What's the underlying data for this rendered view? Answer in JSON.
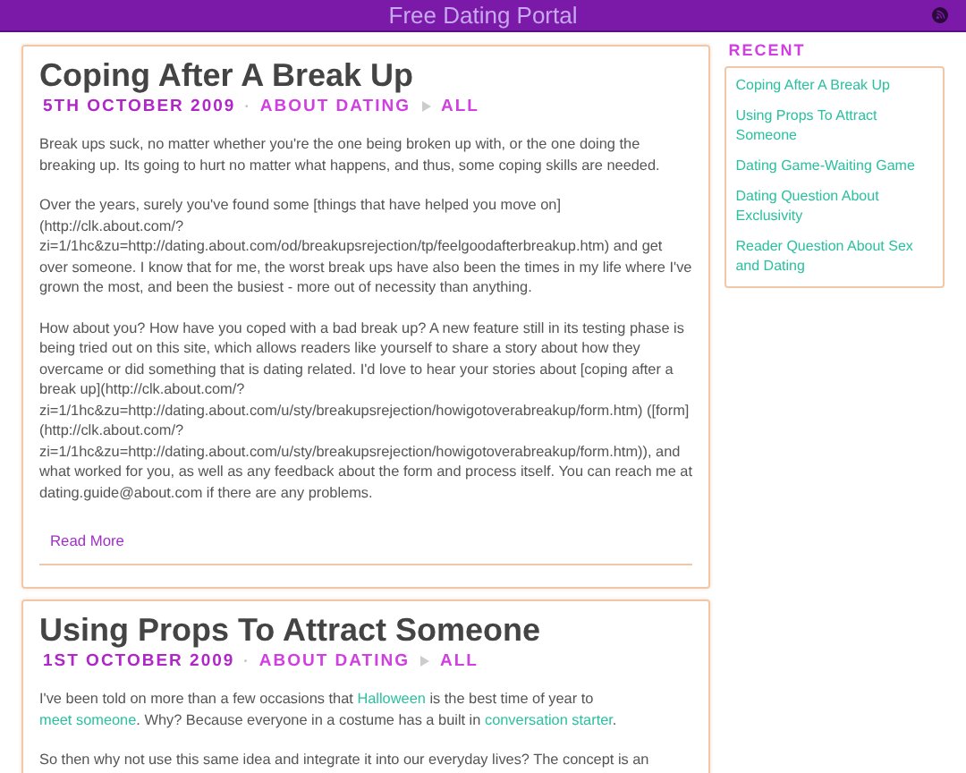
{
  "header": {
    "title": "Free Dating Portal"
  },
  "posts": [
    {
      "title": "Coping After A Break Up",
      "date": "5TH OCTOBER 2009",
      "separator": "·",
      "category": "ABOUT DATING",
      "subcategory": "ALL",
      "paragraphs": [
        [
          {
            "text": "Break ups suck, no matter whether you're the one being broken up with, or the one doing the breaking up. Its going to hurt no matter what happens, and thus, some coping skills are needed.",
            "link": false
          }
        ],
        [
          {
            "text": "Over the years, surely you've found some [things that have helped you move on](http://clk.about.com/?zi=1/1hc&zu=http://dating.about.com/od/breakupsrejection/tp/feelgoodafterbreakup.htm) and get over someone. I know that for me, the worst break ups have also been the times in my life where I've grown the most, and been the busiest - more out of necessity than anything.",
            "link": false
          }
        ],
        [
          {
            "text": "How about you? How have you coped with a bad break up? A new feature still in its testing phase is being tried out on this site, which allows readers like yourself to share a story about how they overcame or did something that is dating related. I'd love to hear your stories about [coping after a break up](http://clk.about.com/?zi=1/1hc&zu=http://dating.about.com/u/sty/breakupsrejection/howigotoverabreakup/form.htm) ([form](http://clk.about.com/?zi=1/1hc&zu=http://dating.about.com/u/sty/breakupsrejection/howigotoverabreakup/form.htm)), and what worked for you, as well as any feedback about the form and process itself. You can reach me at dating.guide@about.com if there are any problems.",
            "link": false
          }
        ]
      ],
      "read_more": "Read More"
    },
    {
      "title": "Using Props To Attract Someone",
      "date": "1ST OCTOBER 2009",
      "separator": "·",
      "category": "ABOUT DATING",
      "subcategory": "ALL",
      "paragraphs": [
        [
          {
            "text": "I've been told on more than a few occasions that ",
            "link": false
          },
          {
            "text": "Halloween",
            "link": true
          },
          {
            "text": " is the best time of year to ",
            "link": false
          },
          {
            "text": "meet someone",
            "link": true
          },
          {
            "text": ". Why? Because everyone in a costume has a built in ",
            "link": false
          },
          {
            "text": "conversation starter",
            "link": true
          },
          {
            "text": ".",
            "link": false
          }
        ],
        [
          {
            "text": "So then why not use this same idea and integrate it into our everyday lives? The concept is an",
            "link": false
          }
        ]
      ]
    }
  ],
  "sidebar": {
    "heading": "RECENT",
    "items": [
      "Coping After A Break Up",
      "Using Props To Attract Someone",
      "Dating Game-Waiting Game",
      "Dating Question About Exclusivity",
      "Reader Question About Sex and Dating"
    ]
  }
}
